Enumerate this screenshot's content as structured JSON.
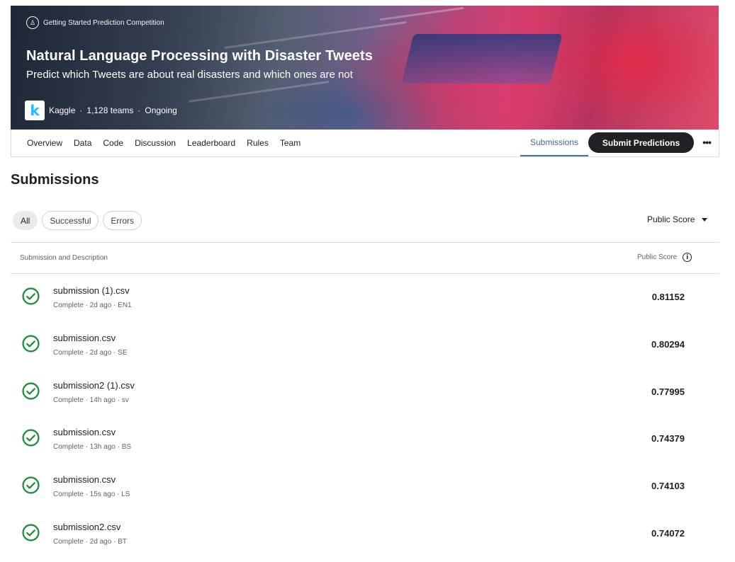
{
  "banner": {
    "competition_type": "Getting Started Prediction Competition",
    "title": "Natural Language Processing with Disaster Tweets",
    "subtitle": "Predict which Tweets are about real disasters and which ones are not",
    "host": "Kaggle",
    "teams": "1,128 teams",
    "status": "Ongoing",
    "logo_letter": "k",
    "separator": "·"
  },
  "nav": {
    "tabs": [
      "Overview",
      "Data",
      "Code",
      "Discussion",
      "Leaderboard",
      "Rules",
      "Team"
    ],
    "active_tab": "Submissions",
    "submit_label": "Submit Predictions",
    "more_glyph": "•••"
  },
  "page": {
    "title": "Submissions",
    "filters": [
      "All",
      "Successful",
      "Errors"
    ],
    "active_filter": "All",
    "sort_label": "Public Score"
  },
  "table": {
    "col_submission": "Submission and Description",
    "col_score": "Public Score",
    "info_glyph": "i",
    "rows": [
      {
        "file": "submission (1).csv",
        "meta": "Complete · 2d ago · EN1",
        "score": "0.81152"
      },
      {
        "file": "submission.csv",
        "meta": "Complete · 2d ago · SE",
        "score": "0.80294"
      },
      {
        "file": "submission2 (1).csv",
        "meta": "Complete · 14h ago · sv",
        "score": "0.77995"
      },
      {
        "file": "submission.csv",
        "meta": "Complete · 13h ago · BS",
        "score": "0.74379"
      },
      {
        "file": "submission.csv",
        "meta": "Complete · 15s ago · LS",
        "score": "0.74103"
      },
      {
        "file": "submission2.csv",
        "meta": "Complete · 2d ago · BT",
        "score": "0.74072"
      }
    ]
  },
  "colors": {
    "success": "#1e8e3e",
    "accent": "#3b6aa0",
    "dark_button": "#202124"
  },
  "icons": {
    "competition": "trophy-icon",
    "status": "check-circle-icon",
    "more": "more-horizontal-icon",
    "info": "info-icon",
    "sort": "caret-down-icon"
  }
}
